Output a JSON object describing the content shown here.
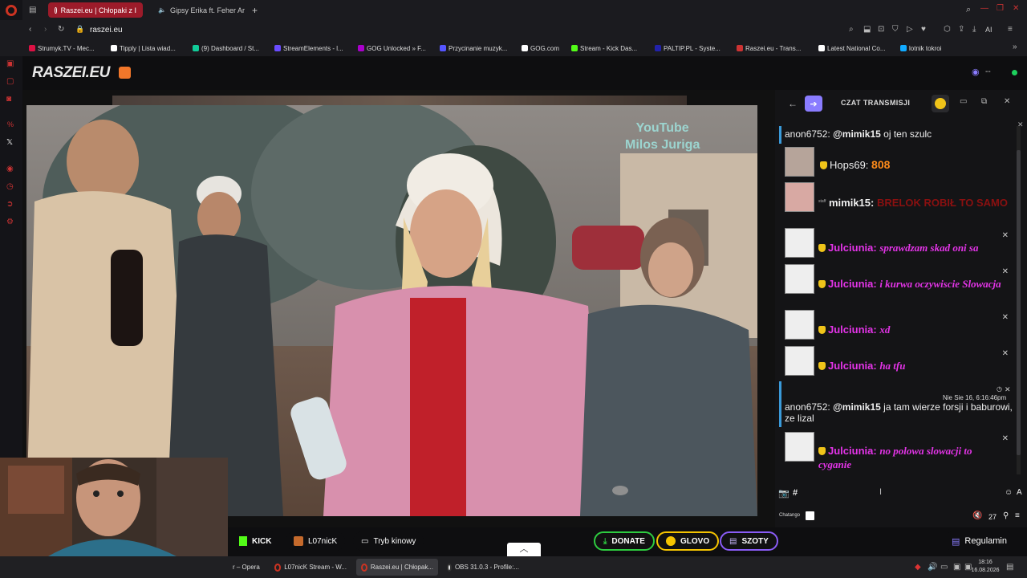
{
  "browser": {
    "tabs": [
      {
        "label": "Raszei.eu | Chłopaki z I",
        "active": true
      },
      {
        "label": "Gipsy Erika ft. Feher Ar",
        "active": false
      }
    ],
    "new_tab": "+",
    "address": "raszei.eu",
    "bookmarks": [
      {
        "label": "Strumyk.TV - Mec...",
        "color": "#d14"
      },
      {
        "label": "Tipply | Lista wiad...",
        "color": "#fff"
      },
      {
        "label": "(9) Dashboard / St...",
        "color": "#1c9"
      },
      {
        "label": "StreamElements - l...",
        "color": "#6a4cff"
      },
      {
        "label": "GOG Unlocked » F...",
        "color": "#a0c"
      },
      {
        "label": "Przycinanie muzyk...",
        "color": "#55f"
      },
      {
        "label": "GOG.com",
        "color": "#fff"
      },
      {
        "label": "Stream - Kick Das...",
        "color": "#53fc18"
      },
      {
        "label": "PALTIP.PL - Syste...",
        "color": "#22a"
      },
      {
        "label": "Raszei.eu - Trans...",
        "color": "#c33"
      },
      {
        "label": "Latest National Co...",
        "color": "#fff"
      },
      {
        "label": "lotnik tokroi",
        "color": "#1af"
      }
    ],
    "more": "»",
    "ai_label": "AI"
  },
  "site": {
    "logo": "RASZEI.EU",
    "viewer_count": "--"
  },
  "video": {
    "watermark_line1": "YouTube",
    "watermark_line2": "Milos Juriga"
  },
  "chat": {
    "title": "CZAT TRANSMISJI",
    "messages": [
      {
        "user": "anon6752:",
        "mention": "@mimik15",
        "text": "oj ten szulc",
        "style": "anon"
      },
      {
        "user": "Hops69:",
        "text": "808",
        "style": "orange"
      },
      {
        "user": "mimik15:",
        "text": "BRELOK ROBIŁ TO SAMO",
        "style": "red"
      },
      {
        "user": "Julciunia:",
        "text": "sprawdzam skad oni sa",
        "style": "pink"
      },
      {
        "user": "Julciunia:",
        "text": "i kurwa oczywiscie Slowacja",
        "style": "pink"
      },
      {
        "user": "Julciunia:",
        "text": "xd",
        "style": "pink"
      },
      {
        "user": "Julciunia:",
        "text": "ha tfu",
        "style": "pink"
      },
      {
        "user": "anon6752:",
        "mention": "@mimik15",
        "text": "ja tam wierze forsji i baburowi, ze lizal",
        "timestamp": "Nie Sie 16, 6:16:46pm",
        "style": "anon"
      },
      {
        "user": "Julciunia:",
        "text": "no polowa slowacji to cyganie",
        "style": "pink"
      }
    ],
    "input_prefix": "#",
    "chatango_label": "Chatango",
    "user_count": "27"
  },
  "bottombar": {
    "kick": "KICK",
    "channel": "L07nicK",
    "cinema": "Tryb kinowy",
    "donate": "DONATE",
    "glovo": "GLOVO",
    "szoty": "SZOTY",
    "rules": "Regulamin"
  },
  "taskbar": {
    "items": [
      "r – Opera",
      "L07nicK Stream - W...",
      "Raszei.eu | Chłopak...",
      "OBS 31.0.3 - Profile:..."
    ],
    "time": "18:16",
    "date": "16.08.2026"
  },
  "colors": {
    "accent_red": "#9c1b2a",
    "donate_green": "#2ecc40",
    "glovo_yellow": "#f5c400",
    "szoty_purple": "#8a5cf6",
    "pink_text": "#e434e8",
    "orange_text": "#ff8c1a"
  }
}
